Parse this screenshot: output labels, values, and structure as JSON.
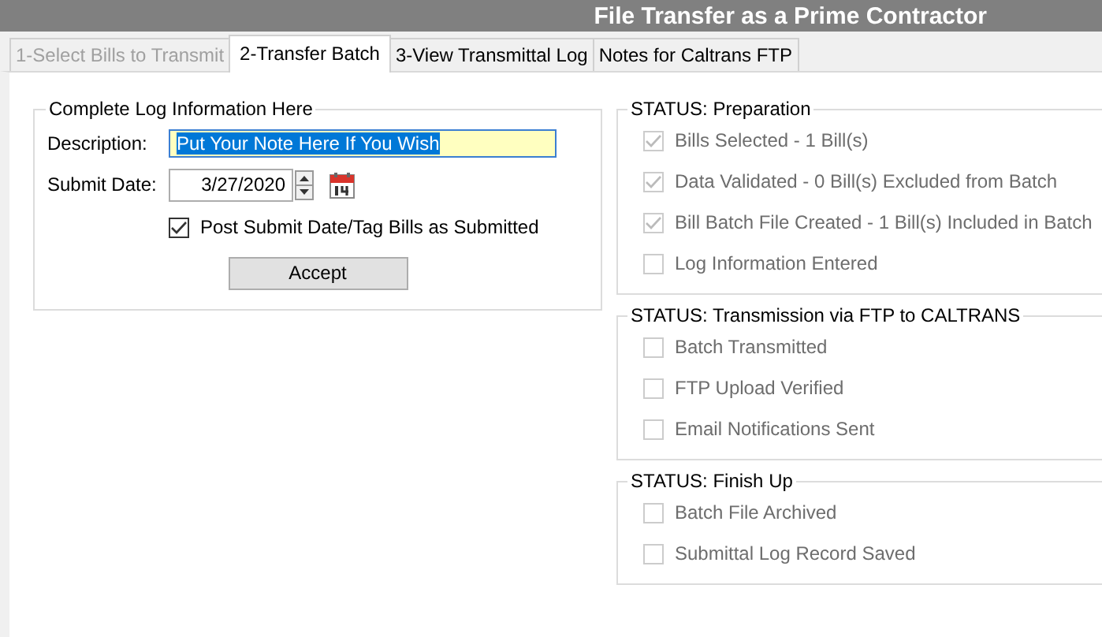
{
  "window": {
    "title": "File Transfer as a Prime Contractor"
  },
  "tabs": [
    {
      "label": "1-Select Bills to Transmit",
      "selected": false,
      "disabled": true
    },
    {
      "label": "2-Transfer Batch",
      "selected": true,
      "disabled": false
    },
    {
      "label": "3-View Transmittal Log",
      "selected": false,
      "disabled": false
    },
    {
      "label": "Notes for Caltrans FTP",
      "selected": false,
      "disabled": false
    }
  ],
  "log_panel": {
    "title": "Complete Log Information Here",
    "description": {
      "label": "Description:",
      "value": "Put Your Note Here If You Wish",
      "text_selected": true
    },
    "submit_date": {
      "label": "Submit Date:",
      "value": "3/27/2020"
    },
    "post_checkbox": {
      "label": "Post Submit Date/Tag Bills as Submitted",
      "checked": true
    },
    "accept_button": {
      "label": "Accept"
    }
  },
  "status_groups": [
    {
      "title": "STATUS: Preparation",
      "items": [
        {
          "label": "Bills Selected - 1 Bill(s)",
          "checked": true,
          "disabled": true
        },
        {
          "label": "Data Validated - 0 Bill(s) Excluded from Batch",
          "checked": true,
          "disabled": true
        },
        {
          "label": "Bill Batch File Created - 1 Bill(s) Included in Batch",
          "checked": true,
          "disabled": true
        },
        {
          "label": "Log Information Entered",
          "checked": false,
          "disabled": true
        }
      ]
    },
    {
      "title": "STATUS: Transmission via FTP to CALTRANS",
      "items": [
        {
          "label": "Batch Transmitted",
          "checked": false,
          "disabled": true
        },
        {
          "label": "FTP Upload Verified",
          "checked": false,
          "disabled": true
        },
        {
          "label": "Email Notifications Sent",
          "checked": false,
          "disabled": true
        }
      ]
    },
    {
      "title": "STATUS: Finish Up",
      "items": [
        {
          "label": "Batch File Archived",
          "checked": false,
          "disabled": true
        },
        {
          "label": "Submittal Log Record Saved",
          "checked": false,
          "disabled": true
        }
      ]
    }
  ]
}
